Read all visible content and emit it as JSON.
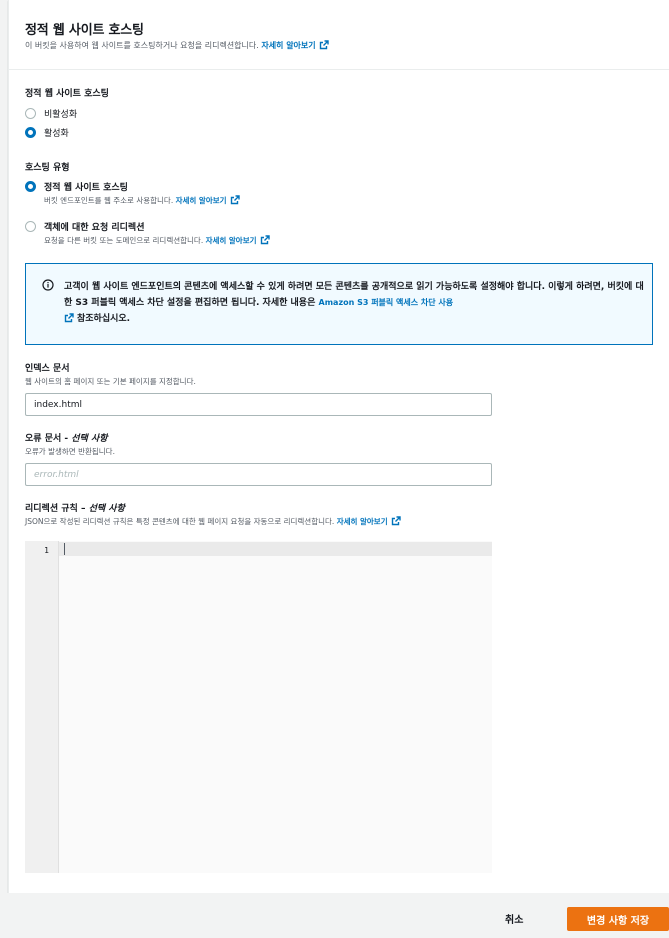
{
  "header": {
    "title": "정적 웹 사이트 호스팅",
    "description": "이 버킷을 사용하여 웹 사이트를 호스팅하거나 요청을 리디렉션합니다.",
    "learn_more": "자세히 알아보기"
  },
  "static_hosting": {
    "label": "정적 웹 사이트 호스팅",
    "options": [
      {
        "label": "비활성화",
        "selected": false
      },
      {
        "label": "활성화",
        "selected": true
      }
    ]
  },
  "hosting_type": {
    "label": "호스팅 유형",
    "options": [
      {
        "label": "정적 웹 사이트 호스팅",
        "description": "버킷 엔드포인트를 웹 주소로 사용합니다.",
        "learn_more": "자세히 알아보기",
        "selected": true
      },
      {
        "label": "객체에 대한 요청 리디렉션",
        "description": "요청을 다른 버킷 또는 도메인으로 리디렉션합니다.",
        "learn_more": "자세히 알아보기",
        "selected": false
      }
    ]
  },
  "alert": {
    "text": "고객이 웹 사이트 엔드포인트의 콘텐츠에 액세스할 수 있게 하려면 모든 콘텐츠를 공개적으로 읽기 가능하도록 설정해야 합니다. 이렇게 하려면, 버킷에 대한 S3 퍼블릭 액세스 차단 설정을 편집하면 됩니다. 자세한 내용은",
    "link": "Amazon S3 퍼블릭 액세스 차단 사용",
    "suffix": "참조하십시오."
  },
  "index_document": {
    "label": "인덱스 문서",
    "description": "웹 사이트의 홈 페이지 또는 기본 페이지를 지정합니다.",
    "value": "index.html"
  },
  "error_document": {
    "label": "오류 문서 - ",
    "optional": "선택 사항",
    "description": "오류가 발생하면 반환됩니다.",
    "placeholder": "error.html",
    "value": ""
  },
  "redirection_rules": {
    "label": "리디렉션 규칙 – ",
    "optional": "선택 사항",
    "description": "JSON으로 작성된 리디렉션 규칙은 특정 콘텐츠에 대한 웹 페이지 요청을 자동으로 리디렉션합니다.",
    "learn_more": "자세히 알아보기",
    "line_number": "1"
  },
  "footer": {
    "cancel_label": "취소",
    "save_label": "변경 사항 저장"
  },
  "colors": {
    "accent": "#0073bb",
    "primary_button": "#ec7211",
    "alert_bg": "#f1faff"
  },
  "icons": [
    "external-link-icon",
    "info-icon"
  ]
}
